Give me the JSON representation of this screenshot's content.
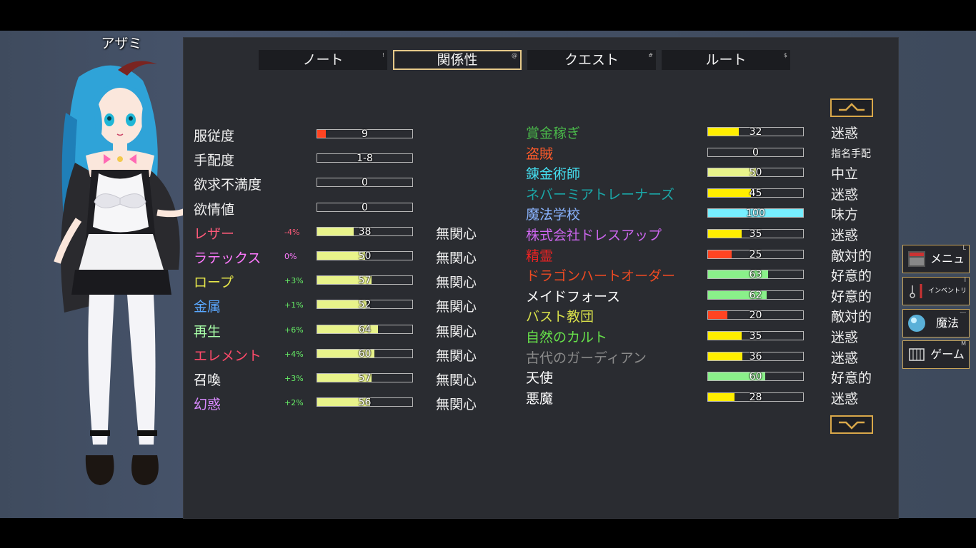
{
  "character": {
    "name": "アザミ"
  },
  "tabs": [
    {
      "label": "ノート",
      "hotkey": "!"
    },
    {
      "label": "関係性",
      "hotkey": "@"
    },
    {
      "label": "クエスト",
      "hotkey": "#"
    },
    {
      "label": "ルート",
      "hotkey": "$"
    }
  ],
  "active_tab": "関係性",
  "stats_plain": [
    {
      "label": "服従度",
      "value": "9",
      "fill": 0.09,
      "fill_color": "#ff4422"
    },
    {
      "label": "手配度",
      "value": "1-8",
      "fill": 0,
      "fill_color": "#ff4422"
    },
    {
      "label": "欲求不満度",
      "value": "0",
      "fill": 0,
      "fill_color": "#ff4422"
    },
    {
      "label": "欲情値",
      "value": "0",
      "fill": 0,
      "fill_color": "#ff4422"
    }
  ],
  "fetishes": [
    {
      "label": "レザー",
      "color": "#ff5a7a",
      "mod": "-4%",
      "mod_color": "#ff5a7a",
      "value": "38",
      "fill": 0.38,
      "status": "無関心"
    },
    {
      "label": "ラテックス",
      "color": "#ff7aff",
      "mod": "0%",
      "mod_color": "#ff7aff",
      "value": "50",
      "fill": 0.5,
      "status": "無関心"
    },
    {
      "label": "ロープ",
      "color": "#e6e64a",
      "mod": "+3%",
      "mod_color": "#66ee66",
      "value": "57",
      "fill": 0.57,
      "status": "無関心"
    },
    {
      "label": "金属",
      "color": "#5aa8ff",
      "mod": "+1%",
      "mod_color": "#66ee66",
      "value": "52",
      "fill": 0.52,
      "status": "無関心"
    },
    {
      "label": "再生",
      "color": "#a8ffa8",
      "mod": "+6%",
      "mod_color": "#66ee66",
      "value": "64",
      "fill": 0.64,
      "status": "無関心"
    },
    {
      "label": "エレメント",
      "color": "#ff4a6a",
      "mod": "+4%",
      "mod_color": "#66ee66",
      "value": "60",
      "fill": 0.6,
      "status": "無関心"
    },
    {
      "label": "召喚",
      "color": "#ffffff",
      "mod": "+3%",
      "mod_color": "#66ee66",
      "value": "57",
      "fill": 0.57,
      "status": "無関心"
    },
    {
      "label": "幻惑",
      "color": "#d98aff",
      "mod": "+2%",
      "mod_color": "#66ee66",
      "value": "56",
      "fill": 0.56,
      "status": "無関心"
    }
  ],
  "fetish_fill_color": "#e8f38a",
  "factions": [
    {
      "label": "賞金稼ぎ",
      "color": "#4ab84a",
      "value": "32",
      "fill": 0.32,
      "fill_color": "#ffee00",
      "status": "迷惑"
    },
    {
      "label": "盗賊",
      "color": "#ff5a2a",
      "value": "0",
      "fill": 0,
      "fill_color": "#ffee00",
      "status": "指名手配"
    },
    {
      "label": "錬金術師",
      "color": "#44ddee",
      "value": "50",
      "fill": 0.5,
      "fill_color": "#e8f38a",
      "status": "中立"
    },
    {
      "label": "ネバーミアトレーナーズ",
      "color": "#1aa8a8",
      "value": "45",
      "fill": 0.45,
      "fill_color": "#ffee00",
      "status": "迷惑"
    },
    {
      "label": "魔法学校",
      "color": "#8ab4ff",
      "value": "100",
      "fill": 1.0,
      "fill_color": "#77eeff",
      "status": "味方"
    },
    {
      "label": "株式会社ドレスアップ",
      "color": "#cc66ee",
      "value": "35",
      "fill": 0.35,
      "fill_color": "#ffee00",
      "status": "迷惑"
    },
    {
      "label": "精霊",
      "color": "#ee2222",
      "value": "25",
      "fill": 0.25,
      "fill_color": "#ff4422",
      "status": "敵対的"
    },
    {
      "label": "ドラゴンハートオーダー",
      "color": "#ee4a22",
      "value": "63",
      "fill": 0.63,
      "fill_color": "#8af08a",
      "status": "好意的"
    },
    {
      "label": "メイドフォース",
      "color": "#ffffff",
      "value": "62",
      "fill": 0.62,
      "fill_color": "#8af08a",
      "status": "好意的"
    },
    {
      "label": "バスト教団",
      "color": "#d8e04a",
      "value": "20",
      "fill": 0.2,
      "fill_color": "#ff4422",
      "status": "敵対的"
    },
    {
      "label": "自然のカルト",
      "color": "#66e04a",
      "value": "35",
      "fill": 0.35,
      "fill_color": "#ffee00",
      "status": "迷惑"
    },
    {
      "label": "古代のガーディアン",
      "color": "#8a8a8a",
      "value": "36",
      "fill": 0.36,
      "fill_color": "#ffee00",
      "status": "迷惑"
    },
    {
      "label": "天使",
      "color": "#ffffff",
      "value": "60",
      "fill": 0.6,
      "fill_color": "#8af08a",
      "status": "好意的"
    },
    {
      "label": "悪魔",
      "color": "#ffffff",
      "value": "28",
      "fill": 0.28,
      "fill_color": "#ffee00",
      "status": "迷惑"
    }
  ],
  "side_menu": [
    {
      "label": "メニュー",
      "hotkey": "L",
      "icon": "menu-book-icon"
    },
    {
      "label": "インベントリ",
      "hotkey": "I",
      "icon": "inventory-icon"
    },
    {
      "label": "魔法",
      "hotkey": "---",
      "icon": "magic-orb-icon"
    },
    {
      "label": "ゲーム",
      "hotkey": "M",
      "icon": "game-gate-icon"
    }
  ]
}
